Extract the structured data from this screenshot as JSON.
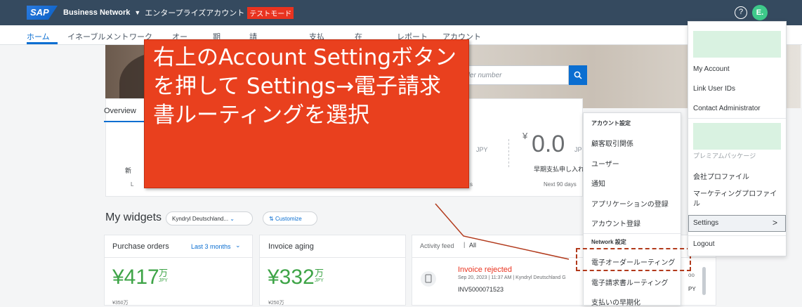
{
  "topbar": {
    "logo": "SAP",
    "product": "Business Network",
    "caret": "▼",
    "account_type": "エンタープライズアカウント",
    "test_mode": "テストモード",
    "help": "?",
    "avatar": "E."
  },
  "nav": {
    "items": [
      "ホーム",
      "イネーブルメント",
      "ワーク",
      "オー",
      "期",
      "請",
      "支払",
      "在",
      "レポート",
      "アカウント"
    ]
  },
  "search": {
    "placeholder": "rder number"
  },
  "overview": {
    "tab": "Overview"
  },
  "kpi": {
    "yen": "¥",
    "value": "0.0",
    "unit_small": "JP",
    "unit_left": "JPY",
    "label": "早期支払申し入れ",
    "period": "Next 90 days",
    "left_char": "新",
    "left_l": "L",
    "s_char": "s"
  },
  "widgets": {
    "title": "My widgets",
    "company": "Kyndryl Deutschland...",
    "caret": "⌄",
    "customize": "Customize"
  },
  "purchase_orders": {
    "title": "Purchase orders",
    "range": "Last 3 months",
    "amount": "¥417",
    "man": "万",
    "jpy": "JPY",
    "axis": "¥350万"
  },
  "invoice_aging": {
    "title": "Invoice aging",
    "amount": "¥332",
    "man": "万",
    "jpy": "JPY",
    "axis": "¥250万"
  },
  "activity": {
    "title": "Activity feed",
    "filter": "All",
    "item_title": "Invoice rejected",
    "item_meta": "Sep 20, 2023 | 11:37 AM | Kyndryl Deutschland G",
    "item_inv": "INV5000071523",
    "peek1": "oo",
    "peek2": "PY"
  },
  "annotation": {
    "text": "右上のAccount Settingボタンを押して Settings→電子請求書ルーティングを選択"
  },
  "submenu": {
    "head1": "アカウント設定",
    "items1": [
      "顧客取引関係",
      "ユーザー",
      "通知",
      "アプリケーションの登録",
      "アカウント登録"
    ],
    "head2": "Network 設定",
    "items2": [
      "電子オーダールーティング",
      "電子請求書ルーティング",
      "支払いの早期化"
    ]
  },
  "account_menu": {
    "items_top": [
      "My Account",
      "Link User IDs",
      "Contact Administrator"
    ],
    "faded": "プレミアムパッケージ",
    "items_mid": [
      "会社プロファイル",
      "マーケティングプロファイル"
    ],
    "settings": "Settings",
    "chevron": ">",
    "logout": "Logout"
  }
}
